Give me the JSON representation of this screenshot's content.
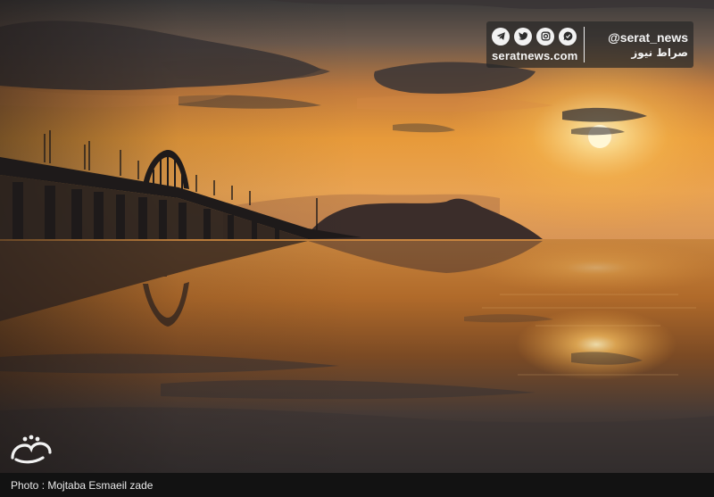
{
  "watermark": {
    "site": "seratnews.com",
    "handle": "@serat_news",
    "name_fa": "صراط نیوز",
    "icons": [
      "telegram-icon",
      "twitter-icon",
      "instagram-icon",
      "check-badge-icon"
    ]
  },
  "caption": "Photo : Mojtaba Esmaeil zade",
  "colors": {
    "sky_top": "#3b3a3a",
    "sky_glow": "#e79a3a",
    "sun": "#fff3c0",
    "water_mid": "#b06a2a",
    "water_bottom": "#262424",
    "silhouette": "#2a2322",
    "caption_bar": "#121212"
  }
}
